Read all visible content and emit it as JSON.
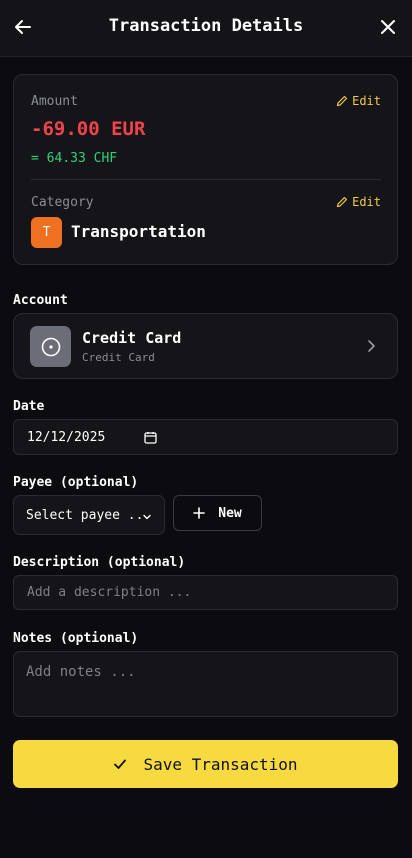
{
  "header": {
    "title": "Transaction Details"
  },
  "amount": {
    "label": "Amount",
    "edit_label": "Edit",
    "value": "-69.00 EUR",
    "converted": "= 64.33 CHF"
  },
  "category": {
    "label": "Category",
    "edit_label": "Edit",
    "badge_letter": "T",
    "name": "Transportation",
    "badge_color": "#f07022"
  },
  "account": {
    "label": "Account",
    "name": "Credit Card",
    "type": "Credit Card"
  },
  "date": {
    "label": "Date",
    "value": "12/12/2025"
  },
  "payee": {
    "label": "Payee (optional)",
    "selected": "Select payee ..",
    "new_label": "New"
  },
  "description": {
    "label": "Description (optional)",
    "placeholder": "Add a description ..."
  },
  "notes": {
    "label": "Notes (optional)",
    "placeholder": "Add notes ..."
  },
  "actions": {
    "save_label": "Save Transaction"
  },
  "colors": {
    "accent": "#f7d940",
    "negative": "#f0434b",
    "positive": "#2fd07a"
  }
}
